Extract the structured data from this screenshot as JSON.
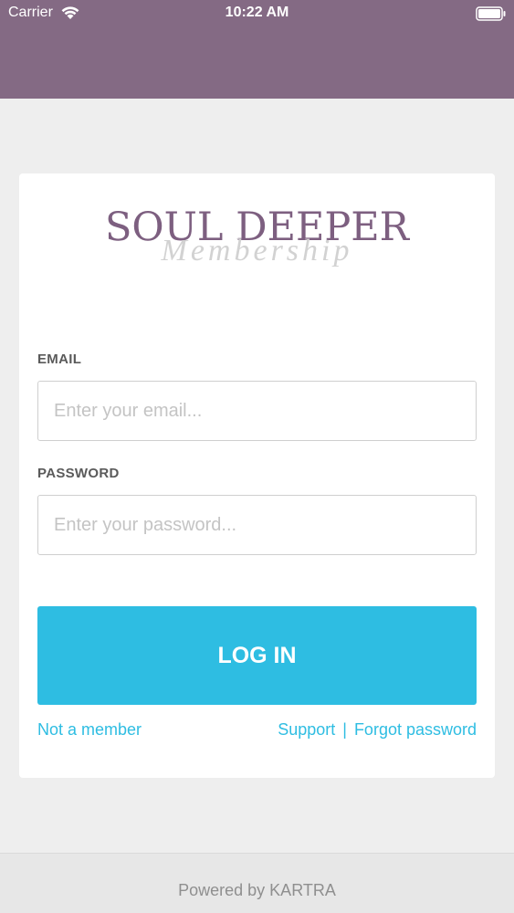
{
  "status_bar": {
    "carrier": "Carrier",
    "time": "10:22 AM"
  },
  "brand": {
    "title": "SOUL DEEPER",
    "script": "Membership",
    "title_color": "#7d5f80",
    "header_color": "#846a84",
    "accent_color": "#2ebde2"
  },
  "form": {
    "email_label": "EMAIL",
    "email_placeholder": "Enter your email...",
    "email_value": "",
    "password_label": "PASSWORD",
    "password_placeholder": "Enter your password...",
    "password_value": "",
    "login_label": "LOG IN"
  },
  "links": {
    "not_member": "Not a member",
    "support": "Support",
    "separator": "|",
    "forgot_password": "Forgot password"
  },
  "footer": {
    "text": "Powered by KARTRA"
  }
}
